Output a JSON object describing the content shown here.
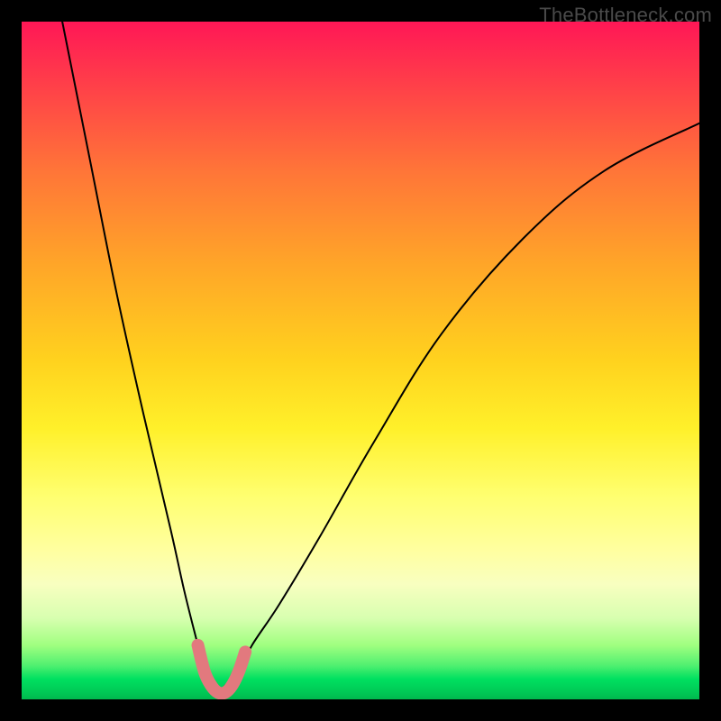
{
  "watermark": "TheBottleneck.com",
  "chart_data": {
    "type": "line",
    "title": "",
    "xlabel": "",
    "ylabel": "",
    "xlim": [
      0,
      100
    ],
    "ylim": [
      0,
      100
    ],
    "series": [
      {
        "name": "bottleneck-curve",
        "x": [
          6,
          10,
          14,
          18,
          22,
          24,
          26,
          27,
          28,
          29,
          30,
          32,
          34,
          38,
          44,
          52,
          62,
          74,
          86,
          100
        ],
        "values": [
          100,
          80,
          60,
          42,
          25,
          16,
          8,
          4,
          2,
          1,
          2,
          4,
          8,
          14,
          24,
          38,
          54,
          68,
          78,
          85
        ]
      },
      {
        "name": "highlight-band",
        "x": [
          26,
          27,
          28,
          29,
          30,
          31,
          32,
          33
        ],
        "values": [
          8,
          4,
          2,
          1,
          1,
          2,
          4,
          7
        ]
      }
    ],
    "colors": {
      "curve": "#000000",
      "highlight": "#e2797e"
    }
  }
}
